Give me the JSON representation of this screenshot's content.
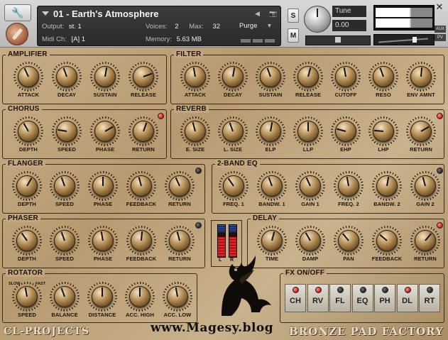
{
  "header": {
    "instrument_name": "01 - Earth's Atmosphere",
    "output_label": "Output:",
    "output_value": "st. 1",
    "midi_label": "Midi Ch:",
    "midi_value": "[A]  1",
    "voices_label": "Voices:",
    "voices_value": "2",
    "max_label": "Max:",
    "max_value": "32",
    "purge_label": "Purge",
    "memory_label": "Memory:",
    "memory_value": "5.63 MB",
    "solo_label": "S",
    "mute_label": "M",
    "tune_label": "Tune",
    "tune_value": "0.00",
    "aux_label": "AUX",
    "pv_label": "PV",
    "close_glyph": "✕",
    "wrench_glyph": "🔧",
    "arrows_glyph": "◀ ▶",
    "camera_glyph": "📷"
  },
  "panels": {
    "amplifier": {
      "title": "AMPLIFIER",
      "knobs": [
        {
          "label": "ATTACK",
          "rot": -25
        },
        {
          "label": "DECAY",
          "rot": -20
        },
        {
          "label": "SUSTAIN",
          "rot": 10
        },
        {
          "label": "RELEASE",
          "rot": 70
        }
      ]
    },
    "filter": {
      "title": "FILTER",
      "knobs": [
        {
          "label": "ATTACK",
          "rot": -10
        },
        {
          "label": "DECAY",
          "rot": 10
        },
        {
          "label": "SUSTAIN",
          "rot": -20
        },
        {
          "label": "RELEASE",
          "rot": 15
        },
        {
          "label": "CUTOFF",
          "rot": -10
        },
        {
          "label": "RESO",
          "rot": -20
        },
        {
          "label": "ENV AMNT",
          "rot": 5
        }
      ]
    },
    "chorus": {
      "title": "CHORUS",
      "led": "on",
      "knobs": [
        {
          "label": "DEPTH",
          "rot": -30
        },
        {
          "label": "SPEED",
          "rot": -80
        },
        {
          "label": "PHASE",
          "rot": 60
        },
        {
          "label": "RETURN",
          "rot": 20
        }
      ]
    },
    "reverb": {
      "title": "REVERB",
      "led": "on",
      "knobs": [
        {
          "label": "E. SIZE",
          "rot": -15
        },
        {
          "label": "L. SIZE",
          "rot": -20
        },
        {
          "label": "ELP",
          "rot": 10
        },
        {
          "label": "LLP",
          "rot": 0
        },
        {
          "label": "EHP",
          "rot": -75
        },
        {
          "label": "LHP",
          "rot": -85
        },
        {
          "label": "RETURN",
          "rot": 60
        }
      ]
    },
    "flanger": {
      "title": "FLANGER",
      "led": "off",
      "knobs": [
        {
          "label": "DEPTH",
          "rot": 30
        },
        {
          "label": "SPEED",
          "rot": -20
        },
        {
          "label": "PHASE",
          "rot": 0
        },
        {
          "label": "FEEDBACK",
          "rot": -15
        },
        {
          "label": "RETURN",
          "rot": -25
        }
      ]
    },
    "eq": {
      "title": "2-BAND EQ",
      "led": "off",
      "knobs": [
        {
          "label": "FREQ. 1",
          "rot": -35
        },
        {
          "label": "BANDW. 1",
          "rot": -20
        },
        {
          "label": "GAIN 1",
          "rot": -25
        },
        {
          "label": "FREQ. 2",
          "rot": -10
        },
        {
          "label": "BANDW. 2",
          "rot": 10
        },
        {
          "label": "GAIN 2",
          "rot": -15
        }
      ]
    },
    "phaser": {
      "title": "PHASER",
      "led": "off",
      "knobs": [
        {
          "label": "DEPTH",
          "rot": -35
        },
        {
          "label": "SPEED",
          "rot": -20
        },
        {
          "label": "PHASE",
          "rot": -10
        },
        {
          "label": "FEEDBACK",
          "rot": 5
        },
        {
          "label": "RETURN",
          "rot": -15
        }
      ]
    },
    "delay": {
      "title": "DELAY",
      "led": "on",
      "knobs": [
        {
          "label": "TIME",
          "rot": 15
        },
        {
          "label": "DAMP",
          "rot": -30
        },
        {
          "label": "PAN",
          "rot": -40
        },
        {
          "label": "FEEDBACK",
          "rot": -50
        },
        {
          "label": "RETURN",
          "rot": 40
        }
      ]
    },
    "rotator": {
      "title": "ROTATOR",
      "slow_label": "SLOW",
      "fast_label": "FAST",
      "knobs": [
        {
          "label": "SPEED",
          "rot": -10
        },
        {
          "label": "BALANCE",
          "rot": -20
        },
        {
          "label": "DISTANCE",
          "rot": 0
        },
        {
          "label": "ACC. HIGH",
          "rot": 0
        },
        {
          "label": "ACC. LOW",
          "rot": -10
        }
      ]
    }
  },
  "vu": {
    "left_label": "L",
    "right_label": "R",
    "left_level": 0.62,
    "right_level": 0.62
  },
  "fx": {
    "title": "FX ON/OFF",
    "buttons": [
      {
        "label": "CH",
        "on": true
      },
      {
        "label": "RV",
        "on": true
      },
      {
        "label": "FL",
        "on": false
      },
      {
        "label": "EQ",
        "on": false
      },
      {
        "label": "PH",
        "on": false
      },
      {
        "label": "DL",
        "on": true
      },
      {
        "label": "RT",
        "on": false
      }
    ]
  },
  "footer": {
    "left_brand": "CL-PROJECTS",
    "right_brand": "BRONZE PAD FACTORY",
    "watermark": "www.Magesy.blog"
  },
  "colors": {
    "led_on": "#d01010",
    "led_off": "#222222",
    "panel_border": "#3a2c1a"
  }
}
